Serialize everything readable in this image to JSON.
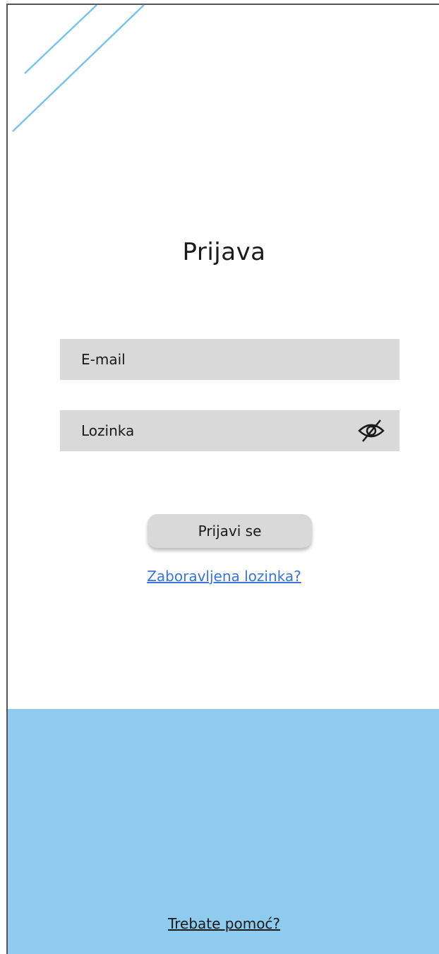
{
  "login": {
    "title": "Prijava",
    "email_placeholder": "E-mail",
    "password_placeholder": "Lozinka",
    "submit_label": "Prijavi se",
    "forgot_password_label": "Zaboravljena lozinka?",
    "help_label": "Trebate pomoć?"
  },
  "icons": {
    "password_toggle": "eye-off-icon"
  },
  "colors": {
    "accent": "#8ecbee",
    "decor_line": "#7cc3ea",
    "field_bg": "#d9d9d9",
    "link": "#3a74d8"
  }
}
